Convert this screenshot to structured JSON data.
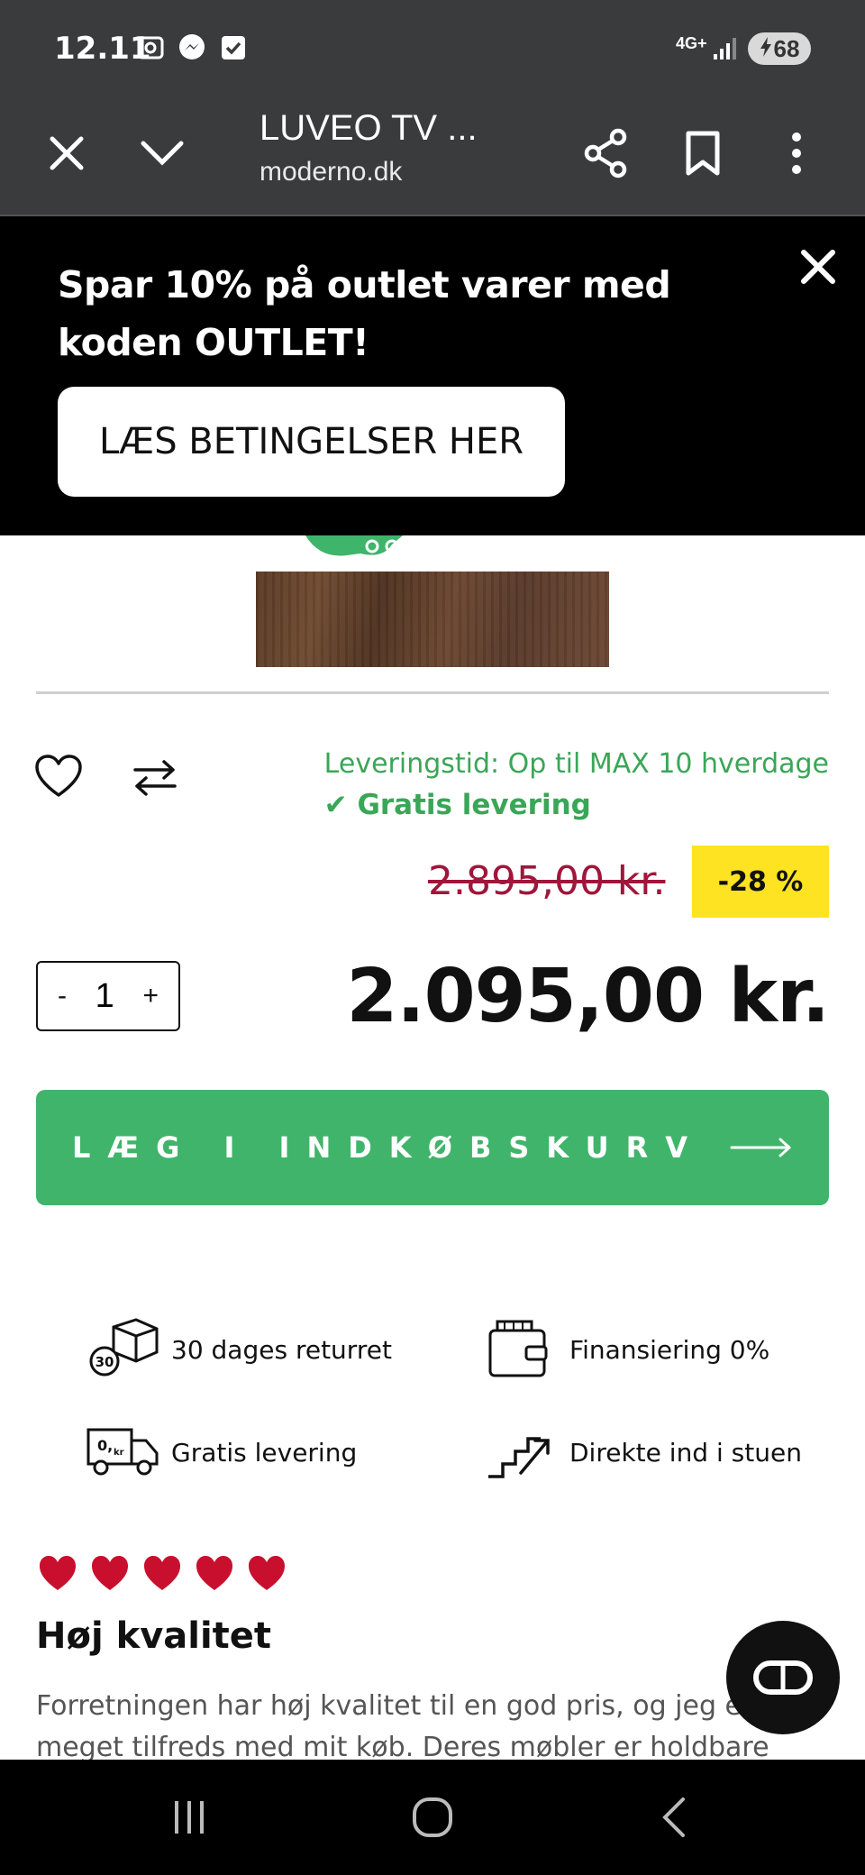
{
  "status_bar": {
    "time": "12.11",
    "network": "4G+",
    "battery": "68"
  },
  "toolbar": {
    "title": "LUVEO TV ...",
    "url": "moderno.dk"
  },
  "promo": {
    "message": "Spar 10% på outlet varer med koden OUTLET!",
    "cta_label": "LÆS BETINGELSER HER"
  },
  "delivery": {
    "time_text": "Leveringstid: Op til MAX 10 hverdage",
    "free_text": "✔ Gratis levering"
  },
  "pricing": {
    "old_price": "2.895,00 kr.",
    "discount_badge": "-28 %",
    "price": "2.095,00 kr."
  },
  "quantity": {
    "minus": "-",
    "value": "1",
    "plus": "+"
  },
  "add_to_cart": {
    "label": "LÆG I INDKØBSKURV"
  },
  "usps": [
    {
      "label": "30 dages returret",
      "icon": "return-box-icon"
    },
    {
      "label": "Finansiering 0%",
      "icon": "wallet-icon"
    },
    {
      "label": "Gratis levering",
      "icon": "delivery-truck-icon"
    },
    {
      "label": "Direkte ind i stuen",
      "icon": "stairs-icon"
    }
  ],
  "review": {
    "rating": 5,
    "rating_max": 5,
    "title": "Høj kvalitet",
    "text": "Forretningen har høj kvalitet til en god pris, og jeg er meget tilfreds med mit køb. Deres møbler er holdbare"
  },
  "colors": {
    "accent_green": "#40b46a",
    "delivery_green": "#3aa657",
    "old_price_red": "#a0163b",
    "badge_yellow": "#fde321",
    "heart_red": "#c8102e",
    "toolbar_gray": "#3a3b3d"
  }
}
